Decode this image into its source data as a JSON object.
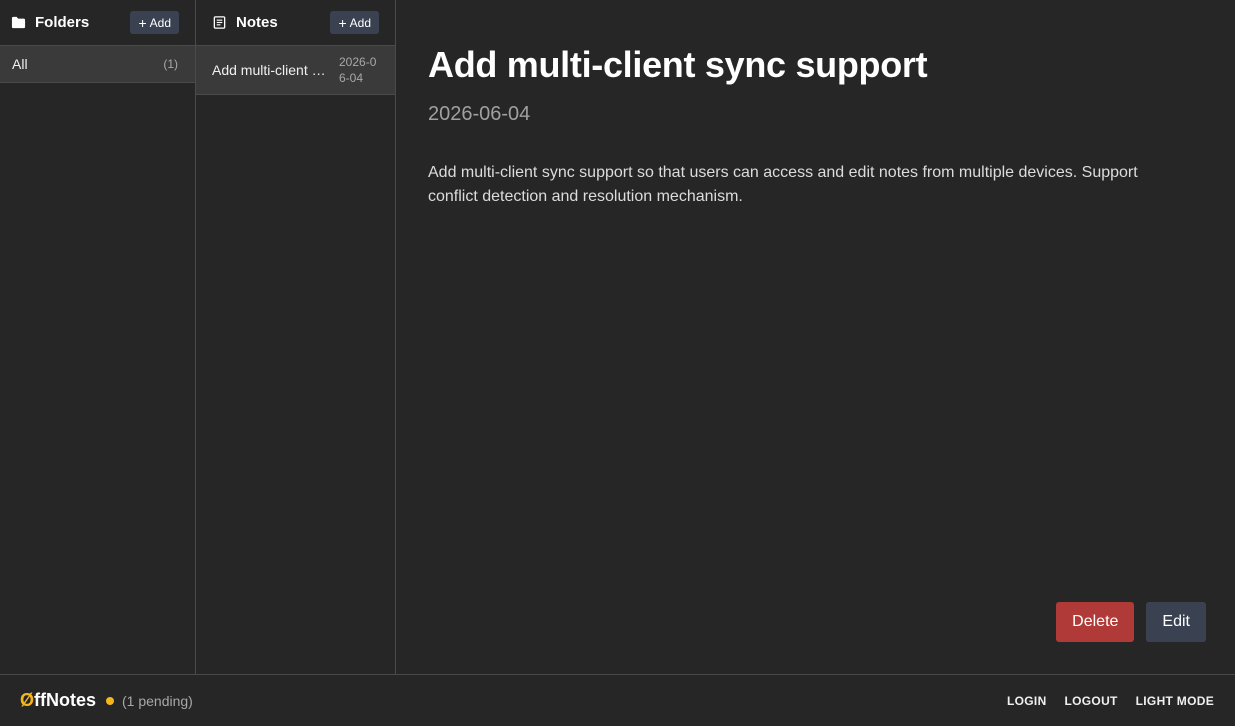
{
  "folders": {
    "title": "Folders",
    "icon": "folder-icon",
    "add_label": "Add",
    "items": [
      {
        "name": "All",
        "count": "(1)"
      }
    ]
  },
  "notes": {
    "title": "Notes",
    "icon": "note-list-icon",
    "add_label": "Add",
    "items": [
      {
        "title": "Add multi-client sync support",
        "date": "2026-06-04"
      }
    ]
  },
  "note": {
    "title": "Add multi-client sync support",
    "date": "2026-06-04",
    "body": "Add multi-client sync support so that users can access and edit notes from multiple devices. Support conflict detection and resolution mechanism.",
    "delete_label": "Delete",
    "edit_label": "Edit"
  },
  "footer": {
    "brand_accent": "Ø",
    "brand_rest": "ffNotes",
    "pending": "(1 pending)",
    "links": [
      "LOGIN",
      "LOGOUT",
      "LIGHT MODE"
    ]
  },
  "colors": {
    "background": "#262626",
    "accent": "#f5b81c",
    "delete": "#b03a37",
    "button": "#3a4252"
  }
}
